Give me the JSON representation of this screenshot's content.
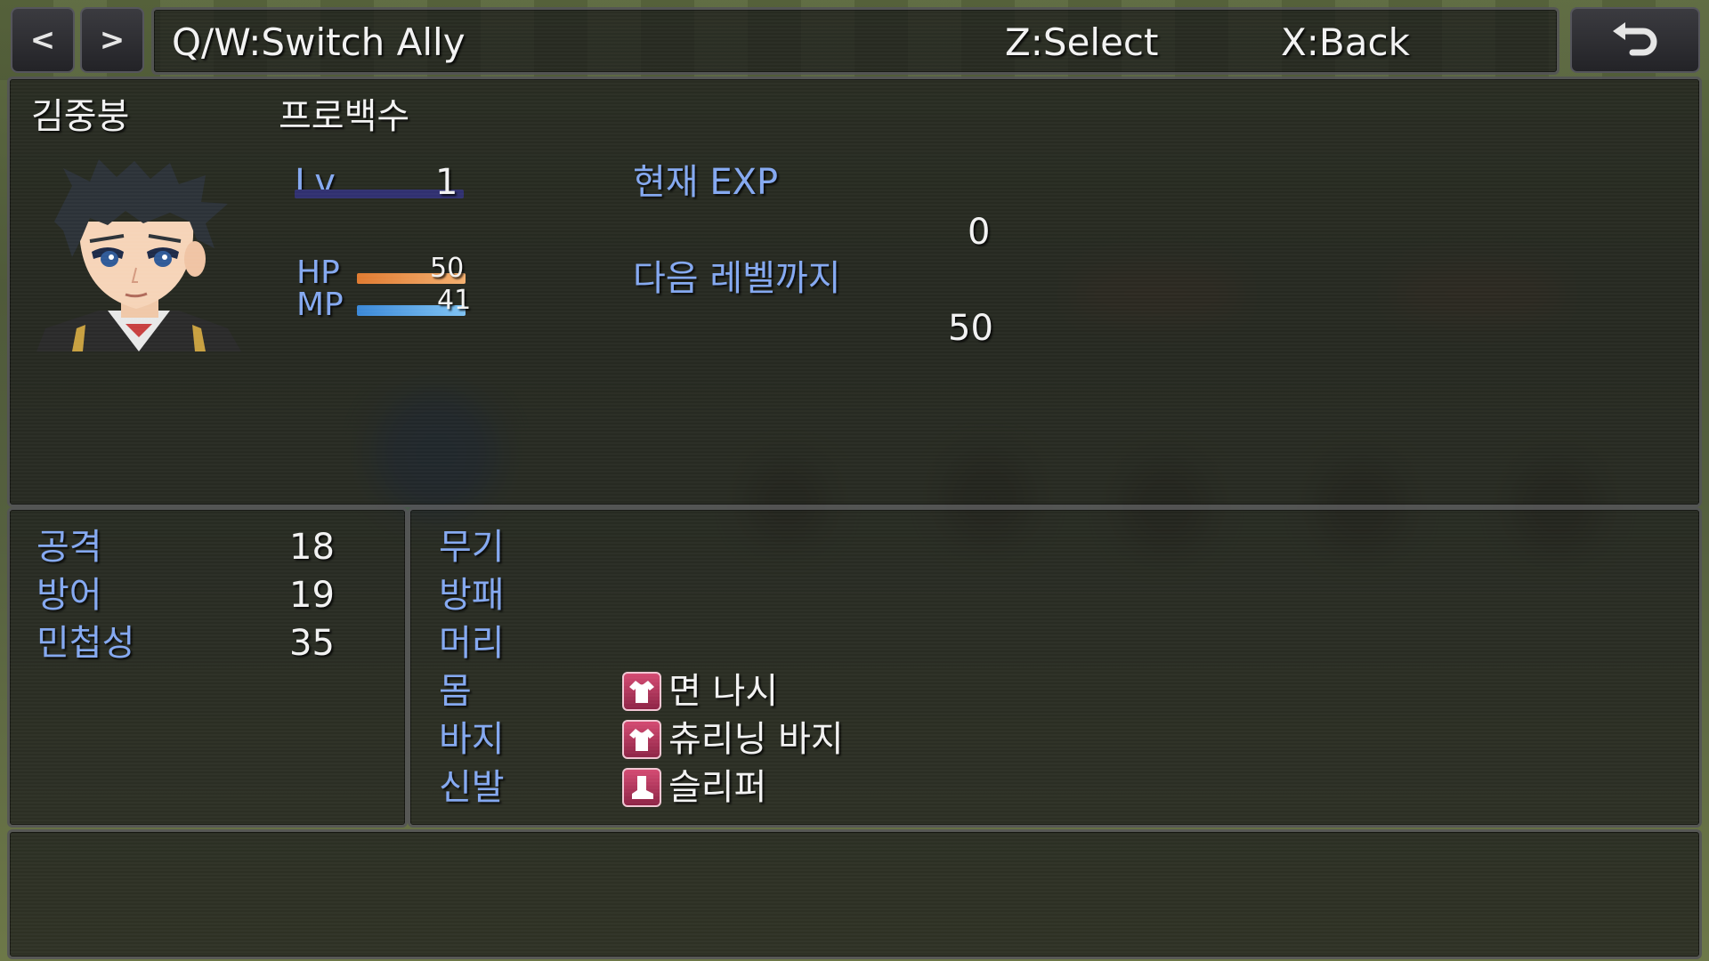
{
  "header": {
    "prev_glyph": "<",
    "next_glyph": ">",
    "help_switch": "Q/W:Switch Ally",
    "help_select": "Z:Select",
    "help_back": "X:Back",
    "back_icon": "undo-arrow-icon"
  },
  "actor": {
    "name": "김중붕",
    "class": "프로백수",
    "level_label": "Lv",
    "level": "1",
    "hp_label": "HP",
    "hp": "50",
    "hp_fill": 1.0,
    "mp_label": "MP",
    "mp": "41",
    "mp_fill": 1.0,
    "exp_current_label": "현재 EXP",
    "exp_current": "0",
    "exp_next_label": "다음 레벨까지",
    "exp_next": "50"
  },
  "params": [
    {
      "label": "공격",
      "value": "18"
    },
    {
      "label": "방어",
      "value": "19"
    },
    {
      "label": "민첩성",
      "value": "35"
    }
  ],
  "equips": [
    {
      "slot": "무기",
      "item": "",
      "icon": ""
    },
    {
      "slot": "방패",
      "item": "",
      "icon": ""
    },
    {
      "slot": "머리",
      "item": "",
      "icon": ""
    },
    {
      "slot": "몸",
      "item": "면 나시",
      "icon": "shirt-icon"
    },
    {
      "slot": "바지",
      "item": "츄리닝 바지",
      "icon": "shirt-icon"
    },
    {
      "slot": "신발",
      "item": "슬리퍼",
      "icon": "boot-icon"
    }
  ],
  "colors": {
    "label_blue": "#84a8f0",
    "hp_gauge": "#e88a3c",
    "mp_gauge": "#4a98e0"
  }
}
